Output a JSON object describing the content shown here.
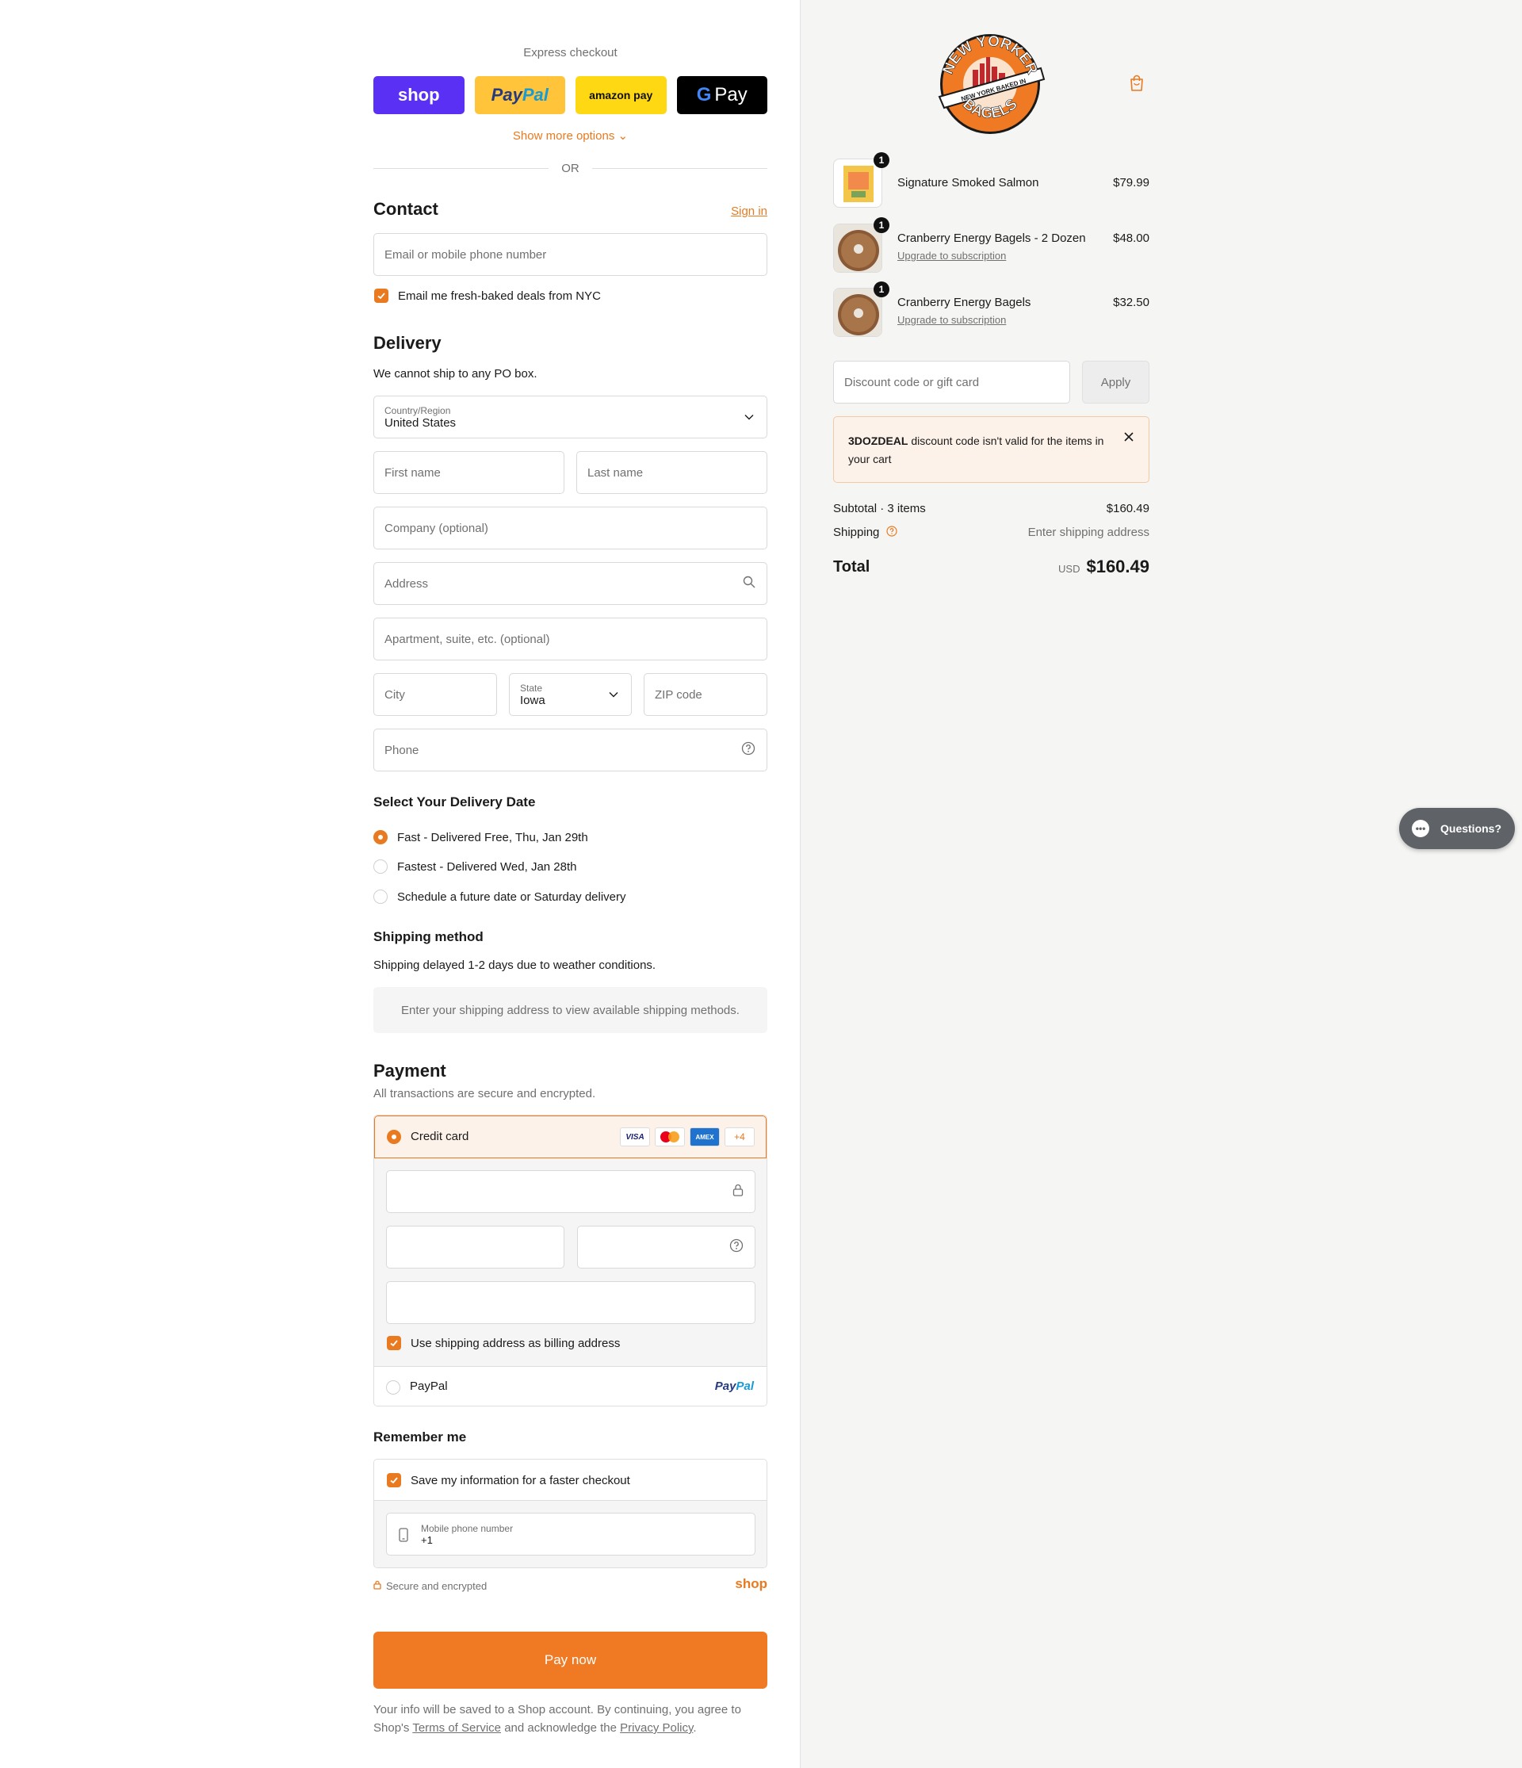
{
  "express": {
    "title": "Express checkout",
    "shop_label": "shop",
    "paypal_label_1": "Pay",
    "paypal_label_2": "Pal",
    "amazon_label": "amazon pay",
    "gpay_label": "Pay",
    "show_more": "Show more options",
    "or": "OR"
  },
  "contact": {
    "title": "Contact",
    "signin": "Sign in",
    "email_placeholder": "Email or mobile phone number",
    "email_optin": "Email me fresh-baked deals from NYC"
  },
  "delivery": {
    "title": "Delivery",
    "note": "We cannot ship to any PO box.",
    "country_label": "Country/Region",
    "country_value": "United States",
    "first_name": "First name",
    "last_name": "Last name",
    "company": "Company (optional)",
    "address": "Address",
    "apartment": "Apartment, suite, etc. (optional)",
    "city": "City",
    "state_label": "State",
    "state_value": "Iowa",
    "zip": "ZIP code",
    "phone": "Phone"
  },
  "delivery_date": {
    "title": "Select Your Delivery Date",
    "options": [
      "Fast - Delivered Free, Thu, Jan 29th",
      "Fastest - Delivered Wed, Jan 28th",
      "Schedule a future date or Saturday delivery"
    ],
    "selected_index": 0
  },
  "shipping": {
    "title": "Shipping method",
    "note": "Shipping delayed 1-2 days due to weather conditions.",
    "placeholder": "Enter your shipping address to view available shipping methods."
  },
  "payment": {
    "title": "Payment",
    "subtitle": "All transactions are secure and encrypted.",
    "credit_card": "Credit card",
    "brands": [
      "VISA",
      "AMEX",
      "+4"
    ],
    "billing_same": "Use shipping address as billing address",
    "paypal": "PayPal",
    "paypal_logo_1": "Pay",
    "paypal_logo_2": "Pal"
  },
  "remember": {
    "title": "Remember me",
    "save_info": "Save my information for a faster checkout",
    "mobile_label": "Mobile phone number",
    "mobile_value": "+1",
    "secure": "Secure and encrypted",
    "shop": "shop"
  },
  "pay_now": "Pay now",
  "legal": {
    "text_1": "Your info will be saved to a Shop account. By continuing, you agree to Shop's",
    "terms": "Terms of Service",
    "text_2": "and acknowledge the",
    "privacy": "Privacy Policy",
    "text_3": "."
  },
  "brand_logo": {
    "top": "NEW YORKER",
    "ribbon": "NEW YORK BAKED IN",
    "bottom": "BAGELS"
  },
  "cart": {
    "items": [
      {
        "qty": "1",
        "name": "Signature Smoked Salmon",
        "price": "$79.99",
        "link": ""
      },
      {
        "qty": "1",
        "name": "Cranberry Energy Bagels - 2 Dozen",
        "price": "$48.00",
        "link": "Upgrade to subscription"
      },
      {
        "qty": "1",
        "name": "Cranberry Energy Bagels",
        "price": "$32.50",
        "link": "Upgrade to subscription"
      }
    ],
    "discount_placeholder": "Discount code or gift card",
    "apply": "Apply",
    "notice_code": "3DOZDEAL",
    "notice_text": "discount code isn't valid for the items in your cart",
    "subtotal_label": "Subtotal · 3 items",
    "subtotal_value": "$160.49",
    "shipping_label": "Shipping",
    "shipping_value": "Enter shipping address",
    "total_label": "Total",
    "total_currency": "USD",
    "total_value": "$160.49"
  },
  "chat": {
    "label": "Questions?"
  },
  "colors": {
    "accent": "#e97a1f",
    "pay_button": "#f07a23",
    "shop_purple": "#5a31f4",
    "paypal_yellow": "#ffc439",
    "amazon_yellow": "#ffd814"
  }
}
